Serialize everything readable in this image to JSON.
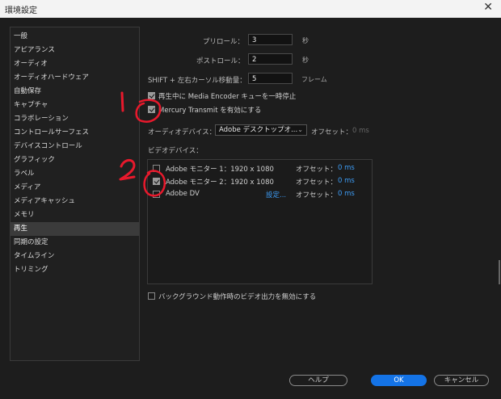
{
  "window": {
    "title": "環境設定"
  },
  "sidebar": {
    "items": [
      {
        "label": "一般"
      },
      {
        "label": "アピアランス"
      },
      {
        "label": "オーディオ"
      },
      {
        "label": "オーディオハードウェア"
      },
      {
        "label": "自動保存"
      },
      {
        "label": "キャプチャ"
      },
      {
        "label": "コラボレーション"
      },
      {
        "label": "コントロールサーフェス"
      },
      {
        "label": "デバイスコントロール"
      },
      {
        "label": "グラフィック"
      },
      {
        "label": "ラベル"
      },
      {
        "label": "メディア"
      },
      {
        "label": "メディアキャッシュ"
      },
      {
        "label": "メモリ"
      },
      {
        "label": "再生"
      },
      {
        "label": "同期の設定"
      },
      {
        "label": "タイムライン"
      },
      {
        "label": "トリミング"
      }
    ],
    "active": "再生"
  },
  "playback": {
    "preroll_label": "プリロール：",
    "preroll_value": "3",
    "preroll_unit": "秒",
    "postroll_label": "ポストロール：",
    "postroll_value": "2",
    "postroll_unit": "秒",
    "shift_label": "SHIFT + 左右カーソル移動量：",
    "shift_value": "5",
    "shift_unit": "フレーム",
    "pause_encoder_label": "再生中に Media Encoder キューを一時停止",
    "mercury_label": "Mercury Transmit を有効にする",
    "audio_device_label": "オーディオデバイス：",
    "audio_device_value": "Adobe デスクトップオ...",
    "audio_offset_label": "オフセット：",
    "audio_offset_value": "0 ms",
    "video_devices_label": "ビデオデバイス：",
    "video_devices": [
      {
        "name": "Adobe モニター 1：1920 x 1080",
        "offset_label": "オフセット：",
        "offset_value": "0 ms",
        "checked": false,
        "setup": ""
      },
      {
        "name": "Adobe モニター 2：1920 x 1080",
        "offset_label": "オフセット：",
        "offset_value": "0 ms",
        "checked": true,
        "setup": ""
      },
      {
        "name": "Adobe DV",
        "offset_label": "オフセット：",
        "offset_value": "0 ms",
        "checked": false,
        "setup": "設定..."
      }
    ],
    "background_label": "バックグラウンド動作時のビデオ出力を無効にする"
  },
  "footer": {
    "help_label": "ヘルプ",
    "ok_label": "OK",
    "cancel_label": "キャンセル"
  },
  "annotations": {
    "mark_1": "1",
    "mark_2": "2"
  },
  "colors": {
    "accent": "#1473e6",
    "annotation": "#e8192c",
    "link": "#3d9cf5"
  }
}
